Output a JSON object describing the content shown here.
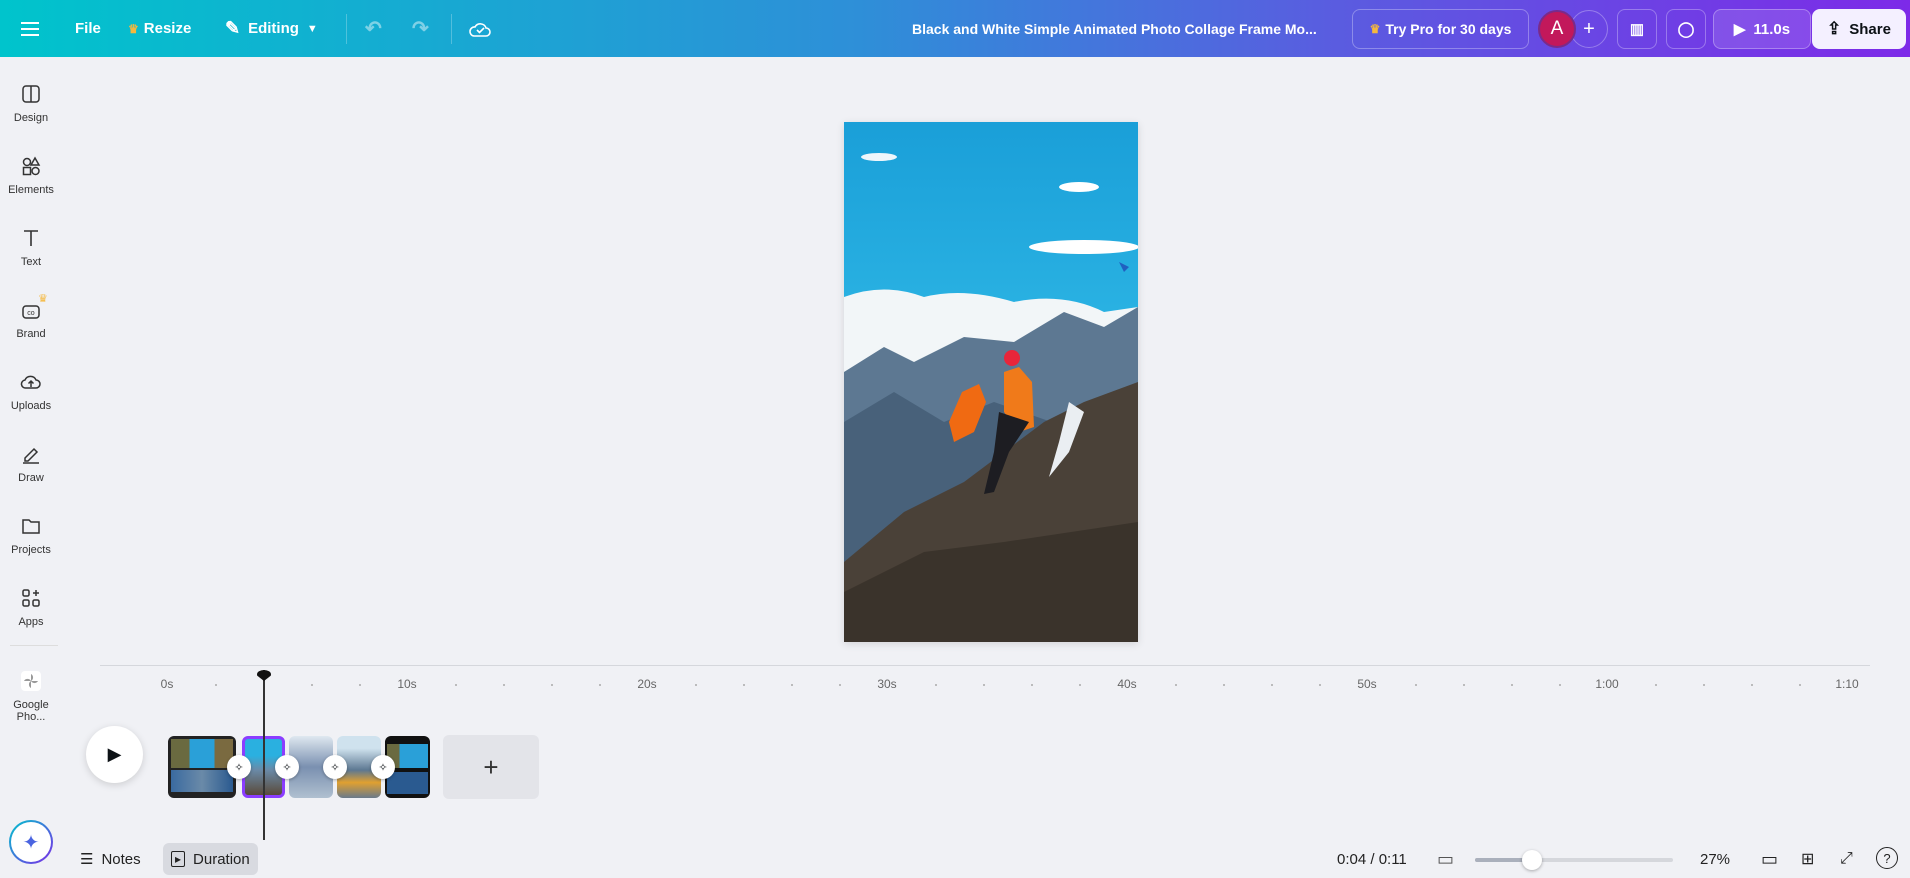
{
  "topbar": {
    "file": "File",
    "resize": "Resize",
    "editing": "Editing",
    "title": "Black and White Simple Animated Photo Collage Frame Mo...",
    "try_pro": "Try Pro for 30 days",
    "avatar": "A",
    "play_duration": "11.0s",
    "share": "Share"
  },
  "sidebar": {
    "items": [
      {
        "label": "Design",
        "icon": "design-icon"
      },
      {
        "label": "Elements",
        "icon": "elements-icon"
      },
      {
        "label": "Text",
        "icon": "text-icon"
      },
      {
        "label": "Brand",
        "icon": "brand-icon"
      },
      {
        "label": "Uploads",
        "icon": "uploads-icon"
      },
      {
        "label": "Draw",
        "icon": "draw-icon"
      },
      {
        "label": "Projects",
        "icon": "folder-icon"
      },
      {
        "label": "Apps",
        "icon": "apps-icon"
      },
      {
        "label": "Google Pho...",
        "icon": "google-photos-icon"
      }
    ]
  },
  "timeline": {
    "labels": [
      "0s",
      "10s",
      "20s",
      "30s",
      "40s",
      "50s",
      "1:00",
      "1:10"
    ],
    "playhead_seconds": 4,
    "clip_count": 5
  },
  "bottombar": {
    "notes": "Notes",
    "duration": "Duration",
    "time": "0:04 / 0:11",
    "zoom": "27%",
    "zoom_fraction": 0.27
  },
  "colors": {
    "accent": "#8b3dff",
    "avatar": "#c2185b"
  }
}
